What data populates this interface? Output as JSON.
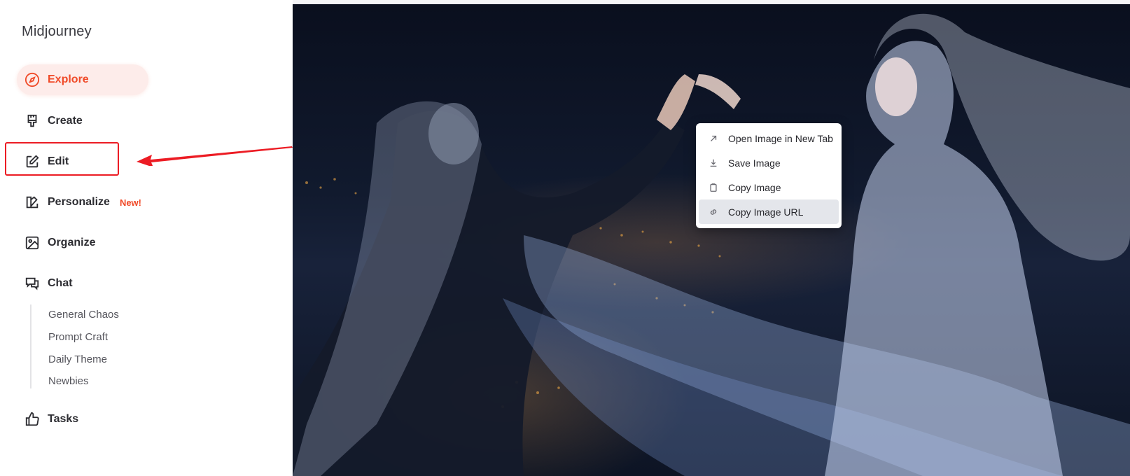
{
  "app": {
    "title": "Midjourney"
  },
  "sidebar": {
    "items": [
      {
        "label": "Explore",
        "icon": "compass-icon",
        "active": true
      },
      {
        "label": "Create",
        "icon": "brush-icon"
      },
      {
        "label": "Edit",
        "icon": "edit-icon"
      },
      {
        "label": "Personalize",
        "icon": "palette-icon",
        "badge": "New!"
      },
      {
        "label": "Organize",
        "icon": "image-icon"
      },
      {
        "label": "Chat",
        "icon": "chat-icon"
      },
      {
        "label": "Tasks",
        "icon": "thumbs-up-icon"
      }
    ],
    "chat_channels": [
      "General Chaos",
      "Prompt Craft",
      "Daily Theme",
      "Newbies"
    ]
  },
  "context_menu": {
    "items": [
      {
        "label": "Open Image in New Tab",
        "icon": "external-arrow-icon"
      },
      {
        "label": "Save Image",
        "icon": "download-icon"
      },
      {
        "label": "Copy Image",
        "icon": "clipboard-icon"
      },
      {
        "label": "Copy Image URL",
        "icon": "link-icon",
        "hovered": true
      }
    ]
  },
  "colors": {
    "accent": "#f04a28",
    "accent_bg": "#fdecea",
    "annotation_red": "#ec1c24"
  }
}
